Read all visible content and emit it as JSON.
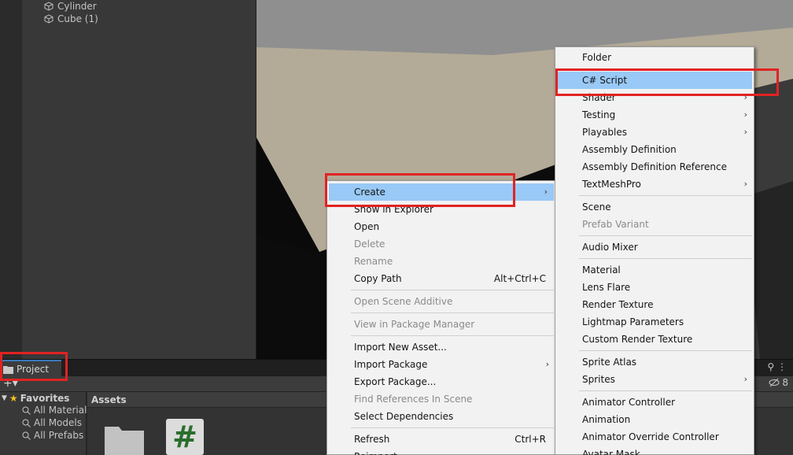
{
  "hierarchy": {
    "items": [
      "Cylinder",
      "Cube (1)"
    ]
  },
  "project_panel": {
    "tab_label": "Project",
    "add_button": "+▾",
    "right_icons": "⚲ ⋮",
    "hidden_count": "8",
    "favorites": {
      "label": "Favorites",
      "items": [
        "All Materials",
        "All Models",
        "All Prefabs"
      ]
    },
    "assets_label": "Assets",
    "script_glyph": "#"
  },
  "context_menu": {
    "items": [
      {
        "label": "Create",
        "submenu": true,
        "highlighted": true
      },
      {
        "label": "Show in Explorer"
      },
      {
        "label": "Open"
      },
      {
        "label": "Delete",
        "disabled": true
      },
      {
        "label": "Rename",
        "disabled": true
      },
      {
        "label": "Copy Path",
        "shortcut": "Alt+Ctrl+C"
      },
      {
        "label": "Open Scene Additive",
        "disabled": true
      },
      {
        "label": "View in Package Manager",
        "disabled": true
      },
      {
        "label": "Import New Asset..."
      },
      {
        "label": "Import Package",
        "submenu": true
      },
      {
        "label": "Export Package..."
      },
      {
        "label": "Find References In Scene",
        "disabled": true
      },
      {
        "label": "Select Dependencies"
      },
      {
        "label": "Refresh",
        "shortcut": "Ctrl+R"
      },
      {
        "label": "Reimport"
      }
    ]
  },
  "create_submenu": {
    "items": [
      {
        "label": "Folder"
      },
      {
        "label": "C# Script",
        "highlighted": true
      },
      {
        "label": "Shader",
        "submenu": true
      },
      {
        "label": "Testing",
        "submenu": true
      },
      {
        "label": "Playables",
        "submenu": true
      },
      {
        "label": "Assembly Definition"
      },
      {
        "label": "Assembly Definition Reference"
      },
      {
        "label": "TextMeshPro",
        "submenu": true
      },
      {
        "label": "Scene"
      },
      {
        "label": "Prefab Variant",
        "disabled": true
      },
      {
        "label": "Audio Mixer"
      },
      {
        "label": "Material"
      },
      {
        "label": "Lens Flare"
      },
      {
        "label": "Render Texture"
      },
      {
        "label": "Lightmap Parameters"
      },
      {
        "label": "Custom Render Texture"
      },
      {
        "label": "Sprite Atlas"
      },
      {
        "label": "Sprites",
        "submenu": true
      },
      {
        "label": "Animator Controller"
      },
      {
        "label": "Animation"
      },
      {
        "label": "Animator Override Controller"
      },
      {
        "label": "Avatar Mask"
      }
    ]
  },
  "colors": {
    "highlight": "#99c9f6",
    "annotation_red": "#e22222",
    "menu_bg": "#f2f2f2"
  }
}
